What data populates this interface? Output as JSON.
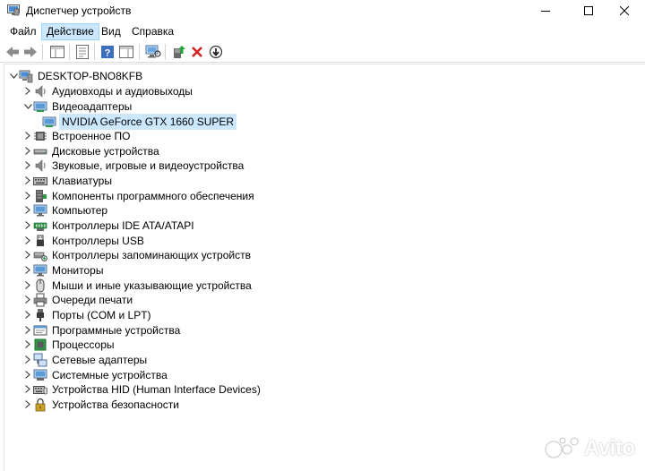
{
  "window": {
    "title": "Диспетчер устройств"
  },
  "menu": [
    {
      "label": "Файл"
    },
    {
      "label": "Действие"
    },
    {
      "label": "Вид"
    },
    {
      "label": "Справка"
    }
  ],
  "tree": {
    "root": "DESKTOP-BNO8KFB",
    "nodes": [
      {
        "label": "Аудиовходы и аудиовыходы",
        "icon": "audio-io-icon"
      },
      {
        "label": "Видеоадаптеры",
        "icon": "display-adapter-icon",
        "expanded": true,
        "children": [
          {
            "label": "NVIDIA GeForce GTX 1660 SUPER",
            "icon": "gpu-icon"
          }
        ]
      },
      {
        "label": "Встроенное ПО",
        "icon": "firmware-icon"
      },
      {
        "label": "Дисковые устройства",
        "icon": "disk-drive-icon"
      },
      {
        "label": "Звуковые, игровые и видеоустройства",
        "icon": "sound-icon"
      },
      {
        "label": "Клавиатуры",
        "icon": "keyboard-icon"
      },
      {
        "label": "Компоненты программного обеспечения",
        "icon": "software-component-icon"
      },
      {
        "label": "Компьютер",
        "icon": "computer-icon"
      },
      {
        "label": "Контроллеры IDE ATA/ATAPI",
        "icon": "ide-controller-icon"
      },
      {
        "label": "Контроллеры USB",
        "icon": "usb-controller-icon"
      },
      {
        "label": "Контроллеры запоминающих устройств",
        "icon": "storage-controller-icon"
      },
      {
        "label": "Мониторы",
        "icon": "monitor-icon"
      },
      {
        "label": "Мыши и иные указывающие устройства",
        "icon": "mouse-icon"
      },
      {
        "label": "Очереди печати",
        "icon": "printer-icon"
      },
      {
        "label": "Порты (COM и LPT)",
        "icon": "port-icon"
      },
      {
        "label": "Программные устройства",
        "icon": "software-device-icon"
      },
      {
        "label": "Процессоры",
        "icon": "processor-icon"
      },
      {
        "label": "Сетевые адаптеры",
        "icon": "network-adapter-icon"
      },
      {
        "label": "Системные устройства",
        "icon": "system-device-icon"
      },
      {
        "label": "Устройства HID (Human Interface Devices)",
        "icon": "hid-icon"
      },
      {
        "label": "Устройства безопасности",
        "icon": "security-device-icon"
      }
    ]
  },
  "watermark": {
    "text": "Avito"
  },
  "colors": {
    "selection": "#cce8ff",
    "accent": "#1e90e6",
    "remove_red": "#d42020"
  }
}
